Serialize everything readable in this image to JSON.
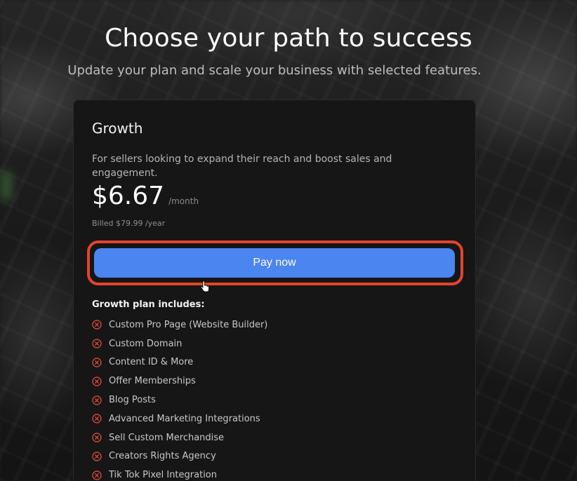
{
  "header": {
    "title": "Choose your path to success",
    "subtitle": "Update your plan and scale your business with selected features."
  },
  "plan": {
    "name": "Growth",
    "description": "For sellers looking to expand their reach and boost sales and engagement.",
    "price": "$6.67",
    "period": "/month",
    "billed": "Billed $79.99 /year",
    "cta_label": "Pay now",
    "includes_title": "Growth plan includes:",
    "features": [
      "Custom Pro Page (Website Builder)",
      "Custom Domain",
      "Content ID & More",
      "Offer Memberships",
      "Blog Posts",
      "Advanced Marketing Integrations",
      "Sell Custom Merchandise",
      "Creators Rights Agency",
      "Tik Tok Pixel Integration"
    ]
  },
  "colors": {
    "accent_button": "#4a85f0",
    "highlight_outline": "#e5442b",
    "excluded_icon": "#d0453a"
  },
  "icons": {
    "feature_status": "x-circle-icon",
    "pointer": "hand-pointer-icon"
  }
}
